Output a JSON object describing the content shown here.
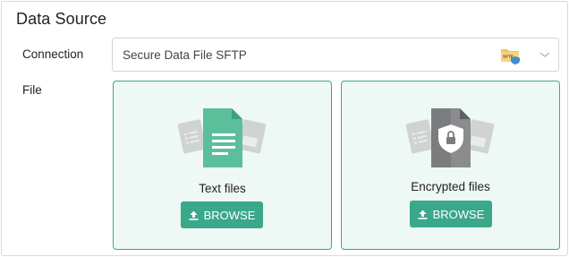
{
  "section": {
    "title": "Data Source"
  },
  "connection": {
    "label": "Connection",
    "selected": "Secure Data File SFTP",
    "badge_text": "SFTP"
  },
  "file": {
    "label": "File",
    "options": [
      {
        "label": "Text files",
        "button": "BROWSE",
        "icon": "text-file-icon"
      },
      {
        "label": "Encrypted files",
        "button": "BROWSE",
        "icon": "encrypted-file-icon"
      }
    ]
  },
  "colors": {
    "accent": "#3aa88a",
    "card_bg": "#eef8f5",
    "muted_file": "#cfd3d2"
  }
}
